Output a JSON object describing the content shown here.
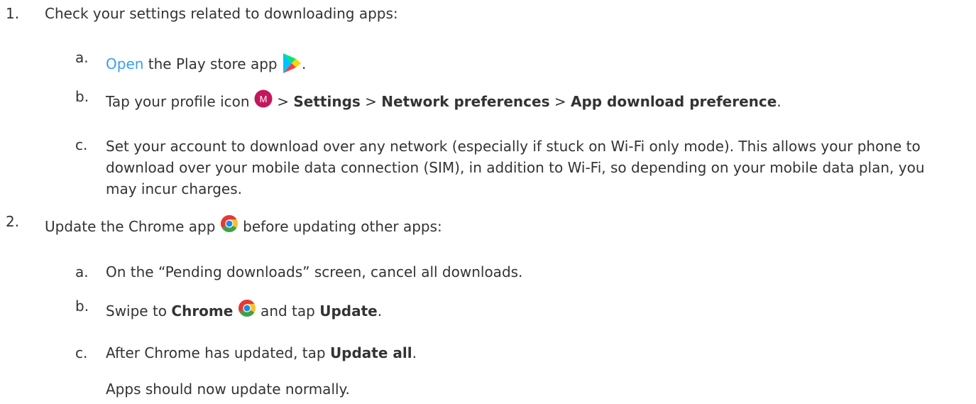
{
  "steps": [
    {
      "number": "1.",
      "text": "Check your settings related to downloading apps:",
      "substeps": [
        {
          "letter": "a.",
          "link": "Open",
          "text_a": " the Play store app ",
          "icon": "play-store-icon",
          "text_b": "."
        },
        {
          "letter": "b.",
          "text_a": "Tap your profile icon ",
          "icon": "profile-avatar-icon",
          "avatar_letter": "M",
          "sep1": " > ",
          "bold1": "Settings",
          "sep2": " > ",
          "bold2": "Network preferences",
          "sep3": " > ",
          "bold3": "App download preference",
          "text_b": "."
        },
        {
          "letter": "c.",
          "text": "Set your account to download over any network (especially if stuck on Wi-Fi only mode). This allows your phone to download over your mobile data connection (SIM), in addition to Wi-Fi, so depending on your mobile data plan, you may incur charges."
        }
      ]
    },
    {
      "number": "2.",
      "text_a": "Update the Chrome app ",
      "icon": "chrome-icon",
      "text_b": " before updating other apps:",
      "substeps": [
        {
          "letter": "a.",
          "text": "On the “Pending downloads” screen, cancel all downloads."
        },
        {
          "letter": "b.",
          "text_a": "Swipe to ",
          "bold1": "Chrome",
          "icon": "chrome-icon",
          "text_b": " and tap ",
          "bold2": "Update",
          "text_c": "."
        },
        {
          "letter": "c.",
          "text_a": "After Chrome has updated, tap ",
          "bold1": "Update all",
          "text_b": "."
        }
      ],
      "note": "Apps should now update normally."
    }
  ],
  "colors": {
    "text": "#333333",
    "link": "#3a9ef5",
    "avatar": "#c2185b"
  }
}
